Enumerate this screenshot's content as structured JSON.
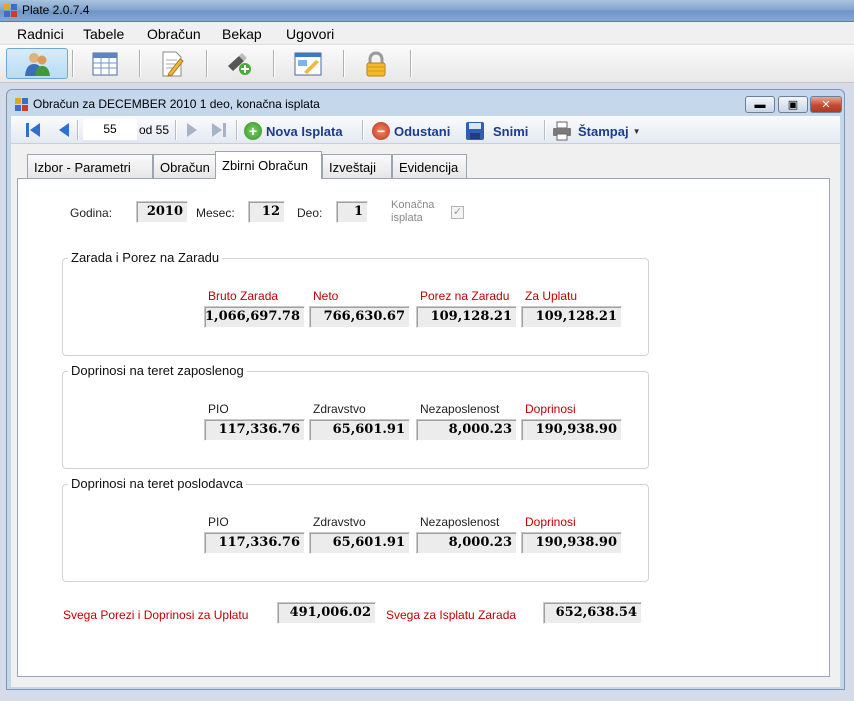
{
  "app": {
    "title": "Plate 2.0.7.4"
  },
  "menu": [
    "Radnici",
    "Tabele",
    "Obračun",
    "Bekap",
    "Ugovori"
  ],
  "toolbar": {
    "icons": [
      "employees-icon",
      "table-icon",
      "document-edit-icon",
      "usb-add-icon",
      "form-icon",
      "lock-icon"
    ]
  },
  "child_window": {
    "title": "Obračun za DECEMBER 2010 1 deo, konačna isplata"
  },
  "navigator": {
    "position": "55",
    "count": "od 55",
    "nova_isplata": "Nova Isplata",
    "odustani": "Odustani",
    "snimi": "Snimi",
    "stampaj": "Štampaj"
  },
  "tabs": [
    "Izbor - Parametri",
    "Obračun",
    "Zbirni Obračun",
    "Izveštaji",
    "Evidencija"
  ],
  "selected_tab": "Zbirni Obračun",
  "header_fields": {
    "godina_label": "Godina:",
    "godina": "2010",
    "mesec_label": "Mesec:",
    "mesec": "12",
    "deo_label": "Deo:",
    "deo": "1",
    "konacna_label_1": "Konačna",
    "konacna_label_2": "isplata",
    "konacna_checked": true
  },
  "groups": [
    {
      "title": "Zarada i Porez na Zaradu",
      "fields": [
        {
          "label": "Bruto Zarada",
          "value": "1,066,697.78",
          "red": true
        },
        {
          "label": "Neto",
          "value": "766,630.67",
          "red": true
        },
        {
          "label": "Porez na Zaradu",
          "value": "109,128.21",
          "red": true
        },
        {
          "label": "Za Uplatu",
          "value": "109,128.21",
          "red": true
        }
      ]
    },
    {
      "title": "Doprinosi na teret zaposlenog",
      "fields": [
        {
          "label": "PIO",
          "value": "117,336.76",
          "red": false
        },
        {
          "label": "Zdravstvo",
          "value": "65,601.91",
          "red": false
        },
        {
          "label": "Nezaposlenost",
          "value": "8,000.23",
          "red": false
        },
        {
          "label": "Doprinosi",
          "value": "190,938.90",
          "red": true
        }
      ]
    },
    {
      "title": "Doprinosi na teret poslodavca",
      "fields": [
        {
          "label": "PIO",
          "value": "117,336.76",
          "red": false
        },
        {
          "label": "Zdravstvo",
          "value": "65,601.91",
          "red": false
        },
        {
          "label": "Nezaposlenost",
          "value": "8,000.23",
          "red": false
        },
        {
          "label": "Doprinosi",
          "value": "190,938.90",
          "red": true
        }
      ]
    }
  ],
  "totals": {
    "porezi_label": "Svega Porezi i Doprinosi za Uplatu",
    "porezi_value": "491,006.02",
    "isplata_label": "Svega za Isplatu Zarada",
    "isplata_value": "652,638.54"
  },
  "colors": {
    "label_red": "#c00000",
    "nav_text": "#1a3c8e"
  }
}
